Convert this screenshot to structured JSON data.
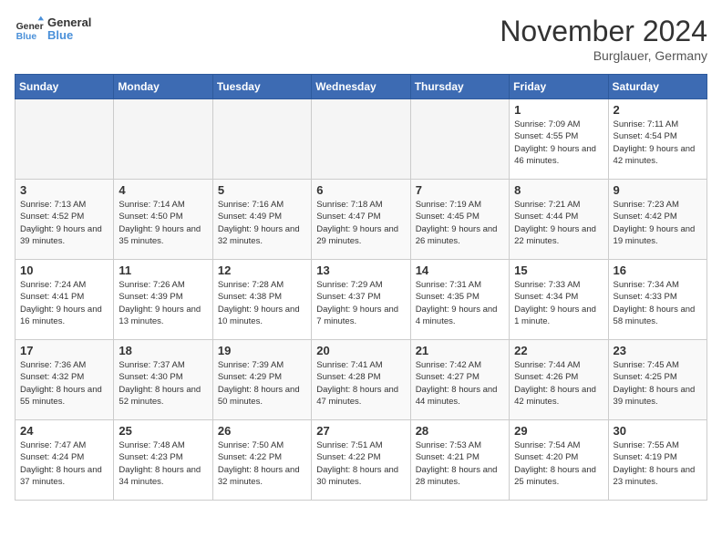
{
  "header": {
    "logo_line1": "General",
    "logo_line2": "Blue",
    "month_title": "November 2024",
    "location": "Burglauer, Germany"
  },
  "weekdays": [
    "Sunday",
    "Monday",
    "Tuesday",
    "Wednesday",
    "Thursday",
    "Friday",
    "Saturday"
  ],
  "weeks": [
    [
      {
        "day": "",
        "empty": true
      },
      {
        "day": "",
        "empty": true
      },
      {
        "day": "",
        "empty": true
      },
      {
        "day": "",
        "empty": true
      },
      {
        "day": "",
        "empty": true
      },
      {
        "day": "1",
        "sunrise": "Sunrise: 7:09 AM",
        "sunset": "Sunset: 4:55 PM",
        "daylight": "Daylight: 9 hours and 46 minutes."
      },
      {
        "day": "2",
        "sunrise": "Sunrise: 7:11 AM",
        "sunset": "Sunset: 4:54 PM",
        "daylight": "Daylight: 9 hours and 42 minutes."
      }
    ],
    [
      {
        "day": "3",
        "sunrise": "Sunrise: 7:13 AM",
        "sunset": "Sunset: 4:52 PM",
        "daylight": "Daylight: 9 hours and 39 minutes."
      },
      {
        "day": "4",
        "sunrise": "Sunrise: 7:14 AM",
        "sunset": "Sunset: 4:50 PM",
        "daylight": "Daylight: 9 hours and 35 minutes."
      },
      {
        "day": "5",
        "sunrise": "Sunrise: 7:16 AM",
        "sunset": "Sunset: 4:49 PM",
        "daylight": "Daylight: 9 hours and 32 minutes."
      },
      {
        "day": "6",
        "sunrise": "Sunrise: 7:18 AM",
        "sunset": "Sunset: 4:47 PM",
        "daylight": "Daylight: 9 hours and 29 minutes."
      },
      {
        "day": "7",
        "sunrise": "Sunrise: 7:19 AM",
        "sunset": "Sunset: 4:45 PM",
        "daylight": "Daylight: 9 hours and 26 minutes."
      },
      {
        "day": "8",
        "sunrise": "Sunrise: 7:21 AM",
        "sunset": "Sunset: 4:44 PM",
        "daylight": "Daylight: 9 hours and 22 minutes."
      },
      {
        "day": "9",
        "sunrise": "Sunrise: 7:23 AM",
        "sunset": "Sunset: 4:42 PM",
        "daylight": "Daylight: 9 hours and 19 minutes."
      }
    ],
    [
      {
        "day": "10",
        "sunrise": "Sunrise: 7:24 AM",
        "sunset": "Sunset: 4:41 PM",
        "daylight": "Daylight: 9 hours and 16 minutes."
      },
      {
        "day": "11",
        "sunrise": "Sunrise: 7:26 AM",
        "sunset": "Sunset: 4:39 PM",
        "daylight": "Daylight: 9 hours and 13 minutes."
      },
      {
        "day": "12",
        "sunrise": "Sunrise: 7:28 AM",
        "sunset": "Sunset: 4:38 PM",
        "daylight": "Daylight: 9 hours and 10 minutes."
      },
      {
        "day": "13",
        "sunrise": "Sunrise: 7:29 AM",
        "sunset": "Sunset: 4:37 PM",
        "daylight": "Daylight: 9 hours and 7 minutes."
      },
      {
        "day": "14",
        "sunrise": "Sunrise: 7:31 AM",
        "sunset": "Sunset: 4:35 PM",
        "daylight": "Daylight: 9 hours and 4 minutes."
      },
      {
        "day": "15",
        "sunrise": "Sunrise: 7:33 AM",
        "sunset": "Sunset: 4:34 PM",
        "daylight": "Daylight: 9 hours and 1 minute."
      },
      {
        "day": "16",
        "sunrise": "Sunrise: 7:34 AM",
        "sunset": "Sunset: 4:33 PM",
        "daylight": "Daylight: 8 hours and 58 minutes."
      }
    ],
    [
      {
        "day": "17",
        "sunrise": "Sunrise: 7:36 AM",
        "sunset": "Sunset: 4:32 PM",
        "daylight": "Daylight: 8 hours and 55 minutes."
      },
      {
        "day": "18",
        "sunrise": "Sunrise: 7:37 AM",
        "sunset": "Sunset: 4:30 PM",
        "daylight": "Daylight: 8 hours and 52 minutes."
      },
      {
        "day": "19",
        "sunrise": "Sunrise: 7:39 AM",
        "sunset": "Sunset: 4:29 PM",
        "daylight": "Daylight: 8 hours and 50 minutes."
      },
      {
        "day": "20",
        "sunrise": "Sunrise: 7:41 AM",
        "sunset": "Sunset: 4:28 PM",
        "daylight": "Daylight: 8 hours and 47 minutes."
      },
      {
        "day": "21",
        "sunrise": "Sunrise: 7:42 AM",
        "sunset": "Sunset: 4:27 PM",
        "daylight": "Daylight: 8 hours and 44 minutes."
      },
      {
        "day": "22",
        "sunrise": "Sunrise: 7:44 AM",
        "sunset": "Sunset: 4:26 PM",
        "daylight": "Daylight: 8 hours and 42 minutes."
      },
      {
        "day": "23",
        "sunrise": "Sunrise: 7:45 AM",
        "sunset": "Sunset: 4:25 PM",
        "daylight": "Daylight: 8 hours and 39 minutes."
      }
    ],
    [
      {
        "day": "24",
        "sunrise": "Sunrise: 7:47 AM",
        "sunset": "Sunset: 4:24 PM",
        "daylight": "Daylight: 8 hours and 37 minutes."
      },
      {
        "day": "25",
        "sunrise": "Sunrise: 7:48 AM",
        "sunset": "Sunset: 4:23 PM",
        "daylight": "Daylight: 8 hours and 34 minutes."
      },
      {
        "day": "26",
        "sunrise": "Sunrise: 7:50 AM",
        "sunset": "Sunset: 4:22 PM",
        "daylight": "Daylight: 8 hours and 32 minutes."
      },
      {
        "day": "27",
        "sunrise": "Sunrise: 7:51 AM",
        "sunset": "Sunset: 4:22 PM",
        "daylight": "Daylight: 8 hours and 30 minutes."
      },
      {
        "day": "28",
        "sunrise": "Sunrise: 7:53 AM",
        "sunset": "Sunset: 4:21 PM",
        "daylight": "Daylight: 8 hours and 28 minutes."
      },
      {
        "day": "29",
        "sunrise": "Sunrise: 7:54 AM",
        "sunset": "Sunset: 4:20 PM",
        "daylight": "Daylight: 8 hours and 25 minutes."
      },
      {
        "day": "30",
        "sunrise": "Sunrise: 7:55 AM",
        "sunset": "Sunset: 4:19 PM",
        "daylight": "Daylight: 8 hours and 23 minutes."
      }
    ]
  ]
}
